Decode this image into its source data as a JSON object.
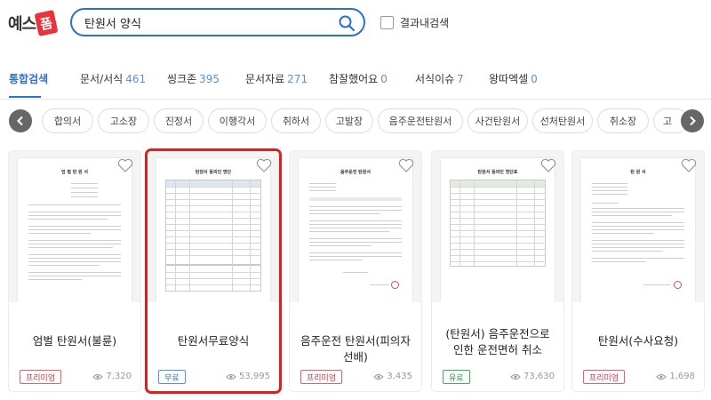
{
  "header": {
    "logo_text": "예스",
    "logo_badge": "폼",
    "search_value": "탄원서 양식",
    "search_placeholder": "",
    "checkbox_label": "결과내검색"
  },
  "tabs": [
    {
      "label": "통합검색",
      "count": ""
    },
    {
      "label": "문서/서식",
      "count": "461"
    },
    {
      "label": "씽크존",
      "count": "395"
    },
    {
      "label": "문서자료",
      "count": "271"
    },
    {
      "label": "참잘했어요",
      "count": "0"
    },
    {
      "label": "서식이슈",
      "count": "7"
    },
    {
      "label": "왕따엑셀",
      "count": "0"
    }
  ],
  "chips": [
    "합의서",
    "고소장",
    "진정서",
    "이행각서",
    "취하서",
    "고발장",
    "음주운전탄원서",
    "사건탄원서",
    "선처탄원서",
    "취소장",
    "고"
  ],
  "cards": [
    {
      "title": "엄벌 탄원서(불륜)",
      "badge": "프리미엄",
      "views": "7,320",
      "doc_title": "엄 벌 탄 원 서"
    },
    {
      "title": "탄원서무료양식",
      "badge": "무료",
      "views": "53,995",
      "doc_title": "탄원서 동의인 명단"
    },
    {
      "title": "음주운전 탄원서(피의자 선배)",
      "badge": "프리미엄",
      "views": "3,435",
      "doc_title": "음주운전 탄원서"
    },
    {
      "title": "(탄원서) 음주운전으로 인한 운전면허 취소",
      "badge": "유료",
      "views": "73,630",
      "doc_title": "탄원서 동의인 명단표"
    },
    {
      "title": "탄원서(수사요청)",
      "badge": "프리미엄",
      "views": "1,698",
      "doc_title": "탄 원 서"
    }
  ],
  "colors": {
    "accent": "#2a6fd6",
    "selection": "#e01e1e",
    "premium": "#e03040",
    "paid": "#2a9a4a"
  }
}
